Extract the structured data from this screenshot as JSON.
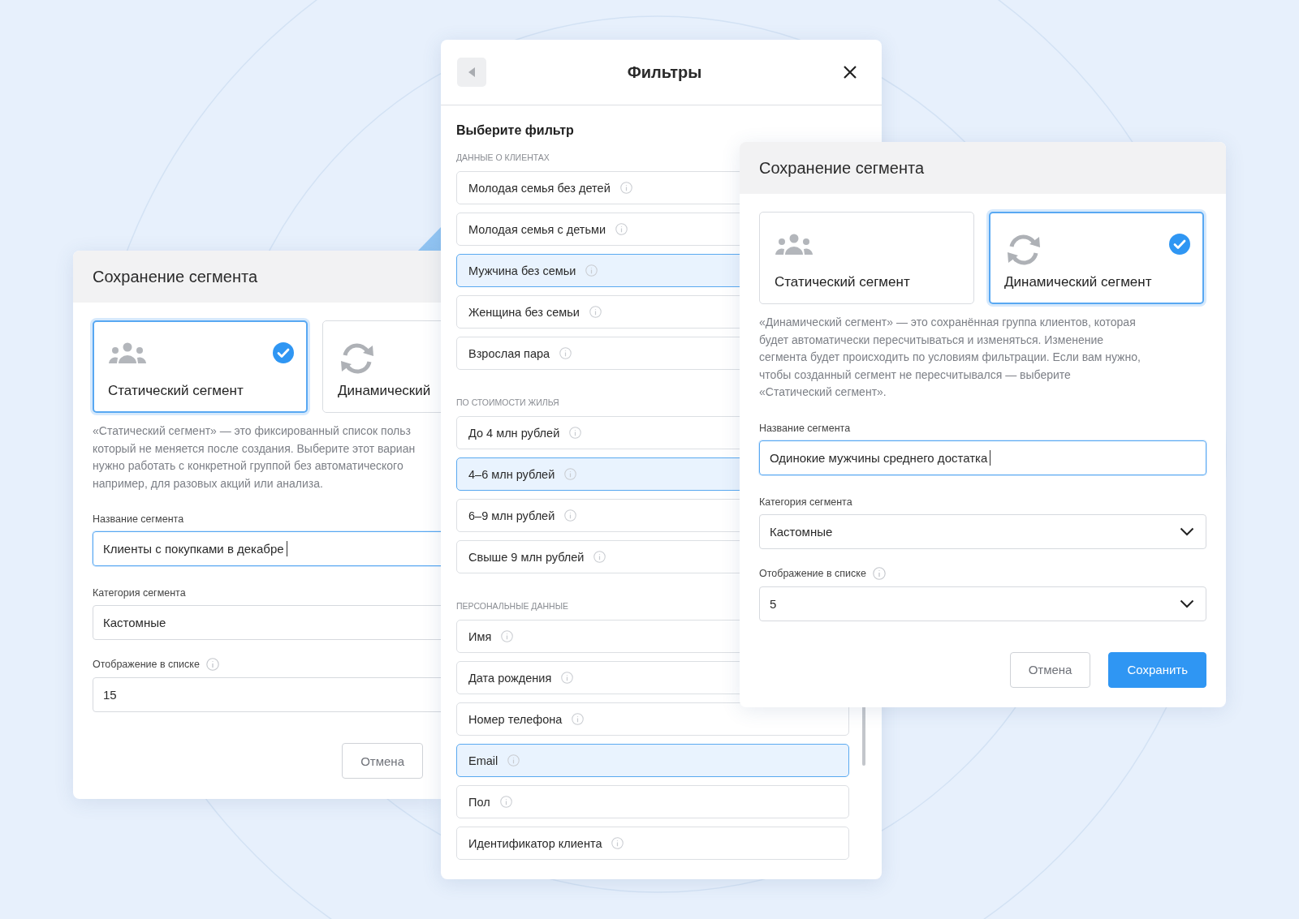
{
  "left_dialog": {
    "title": "Сохранение сегмента",
    "segment_types": [
      {
        "kind": "static",
        "label": "Статический сегмент",
        "selected": true
      },
      {
        "kind": "dynamic",
        "label": "Динамический",
        "selected": false
      }
    ],
    "description_lines": [
      "«Статический сегмент» — это фиксированный список польз",
      "который не меняется после создания. Выберите этот вариан",
      "нужно работать с конкретной группой без автоматического",
      "например, для разовых акций или анализа."
    ],
    "name_field": {
      "label": "Название сегмента",
      "value": "Клиенты с покупками в декабре",
      "focused": true
    },
    "category_field": {
      "label": "Категория сегмента",
      "value": "Кастомные",
      "dropdown": false
    },
    "display_field": {
      "label": "Отображение в списке",
      "value": "15",
      "dropdown": false
    },
    "buttons": [
      {
        "kind": "secondary",
        "label": "Отмена"
      }
    ]
  },
  "filters_dialog": {
    "title": "Фильтры",
    "heading": "Выберите фильтр",
    "groups": [
      {
        "title": "ДАННЫЕ О КЛИЕНТАХ",
        "items": [
          {
            "label": "Молодая семья без детей",
            "selected": false
          },
          {
            "label": "Молодая семья с детьми",
            "selected": false
          },
          {
            "label": "Мужчина без семьи",
            "selected": true
          },
          {
            "label": "Женщина без семьи",
            "selected": false
          },
          {
            "label": "Взрослая пара",
            "selected": false
          }
        ]
      },
      {
        "title": "ПО СТОИМОСТИ ЖИЛЬЯ",
        "items": [
          {
            "label": "До 4 млн рублей",
            "selected": false
          },
          {
            "label": "4–6 млн рублей",
            "selected": true
          },
          {
            "label": "6–9 млн рублей",
            "selected": false
          },
          {
            "label": "Свыше 9 млн рублей",
            "selected": false
          }
        ]
      },
      {
        "title": "ПЕРСОНАЛЬНЫЕ ДАННЫЕ",
        "items": [
          {
            "label": "Имя",
            "selected": false
          },
          {
            "label": "Дата рождения",
            "selected": false
          },
          {
            "label": "Номер телефона",
            "selected": false
          },
          {
            "label": "Email",
            "selected": true
          },
          {
            "label": "Пол",
            "selected": false
          },
          {
            "label": "Идентификатор клиента",
            "selected": false
          }
        ]
      }
    ]
  },
  "right_dialog": {
    "title": "Сохранение сегмента",
    "segment_types": [
      {
        "kind": "static",
        "label": "Статический сегмент",
        "selected": false
      },
      {
        "kind": "dynamic",
        "label": "Динамический сегмент",
        "selected": true
      }
    ],
    "description_lines": [
      "«Динамический сегмент» — это сохранённая группа клиентов, которая",
      "будет автоматически пересчитываться и изменяться. Изменение",
      "сегмента будет происходить по условиям фильтрации. Если вам нужно,",
      "чтобы созданный сегмент не пересчитывался — выберите",
      "«Статический сегмент»."
    ],
    "name_field": {
      "label": "Название сегмента",
      "value": "Одинокие мужчины среднего достатка",
      "focused": true
    },
    "category_field": {
      "label": "Категория сегмента",
      "value": "Кастомные",
      "dropdown": true
    },
    "display_field": {
      "label": "Отображение в списке",
      "value": "5",
      "dropdown": true
    },
    "buttons": [
      {
        "kind": "secondary",
        "label": "Отмена"
      },
      {
        "kind": "primary",
        "label": "Сохранить"
      }
    ]
  }
}
